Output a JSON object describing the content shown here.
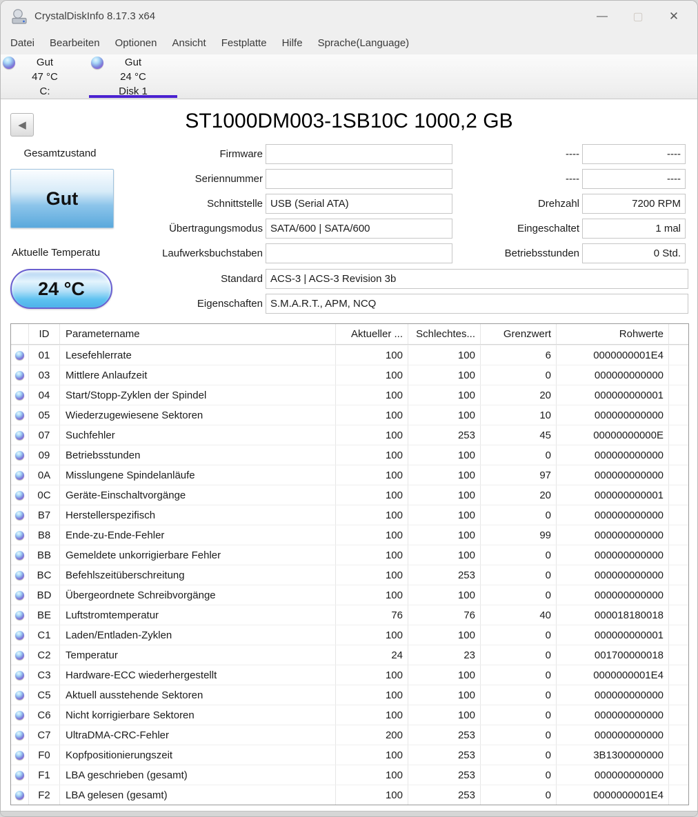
{
  "window": {
    "title": "CrystalDiskInfo 8.17.3 x64"
  },
  "icons": {
    "back": "◀",
    "minimize": "—",
    "maximize": "▢",
    "close": "✕"
  },
  "menu": {
    "items": [
      {
        "label": "Datei"
      },
      {
        "label": "Bearbeiten"
      },
      {
        "label": "Optionen"
      },
      {
        "label": "Ansicht"
      },
      {
        "label": "Festplatte"
      },
      {
        "label": "Hilfe"
      },
      {
        "label": "Sprache(Language)"
      }
    ]
  },
  "disk_tabs": [
    {
      "status": "Gut",
      "temperature": "47 °C",
      "name": "C:",
      "selected": false
    },
    {
      "status": "Gut",
      "temperature": "24 °C",
      "name": "Disk 1",
      "selected": true
    }
  ],
  "drive": {
    "title": "ST1000DM003-1SB10C 1000,2 GB",
    "health_label": "Gesamtzustand",
    "health_value": "Gut",
    "temp_label": "Aktuelle Temperatu",
    "temp_value": "24 °C",
    "fields_left": [
      {
        "label": "Firmware",
        "value": ""
      },
      {
        "label": "Seriennummer",
        "value": ""
      },
      {
        "label": "Schnittstelle",
        "value": "USB (Serial ATA)"
      },
      {
        "label": "Übertragungsmodus",
        "value": "SATA/600 | SATA/600"
      },
      {
        "label": "Laufwerksbuchstaben",
        "value": ""
      }
    ],
    "fields_right": [
      {
        "label": "----",
        "value": "----"
      },
      {
        "label": "----",
        "value": "----"
      },
      {
        "label": "Drehzahl",
        "value": "7200 RPM"
      },
      {
        "label": "Eingeschaltet",
        "value": "1 mal"
      },
      {
        "label": "Betriebsstunden",
        "value": "0 Std."
      }
    ],
    "fields_wide": [
      {
        "label": "Standard",
        "value": "ACS-3 | ACS-3 Revision 3b"
      },
      {
        "label": "Eigenschaften",
        "value": "S.M.A.R.T., APM, NCQ"
      }
    ]
  },
  "smart_table": {
    "headers": {
      "id": "ID",
      "name": "Parametername",
      "current": "Aktueller ...",
      "worst": "Schlechtes...",
      "threshold": "Grenzwert",
      "raw": "Rohwerte"
    },
    "rows": [
      {
        "id": "01",
        "name": "Lesefehlerrate",
        "current": "100",
        "worst": "100",
        "threshold": "6",
        "raw": "0000000001E4"
      },
      {
        "id": "03",
        "name": "Mittlere Anlaufzeit",
        "current": "100",
        "worst": "100",
        "threshold": "0",
        "raw": "000000000000"
      },
      {
        "id": "04",
        "name": "Start/Stopp-Zyklen der Spindel",
        "current": "100",
        "worst": "100",
        "threshold": "20",
        "raw": "000000000001"
      },
      {
        "id": "05",
        "name": "Wiederzugewiesene Sektoren",
        "current": "100",
        "worst": "100",
        "threshold": "10",
        "raw": "000000000000"
      },
      {
        "id": "07",
        "name": "Suchfehler",
        "current": "100",
        "worst": "253",
        "threshold": "45",
        "raw": "00000000000E"
      },
      {
        "id": "09",
        "name": "Betriebsstunden",
        "current": "100",
        "worst": "100",
        "threshold": "0",
        "raw": "000000000000"
      },
      {
        "id": "0A",
        "name": "Misslungene Spindelanläufe",
        "current": "100",
        "worst": "100",
        "threshold": "97",
        "raw": "000000000000"
      },
      {
        "id": "0C",
        "name": "Geräte-Einschaltvorgänge",
        "current": "100",
        "worst": "100",
        "threshold": "20",
        "raw": "000000000001"
      },
      {
        "id": "B7",
        "name": "Herstellerspezifisch",
        "current": "100",
        "worst": "100",
        "threshold": "0",
        "raw": "000000000000"
      },
      {
        "id": "B8",
        "name": "Ende-zu-Ende-Fehler",
        "current": "100",
        "worst": "100",
        "threshold": "99",
        "raw": "000000000000"
      },
      {
        "id": "BB",
        "name": "Gemeldete unkorrigierbare Fehler",
        "current": "100",
        "worst": "100",
        "threshold": "0",
        "raw": "000000000000"
      },
      {
        "id": "BC",
        "name": "Befehlszeitüberschreitung",
        "current": "100",
        "worst": "253",
        "threshold": "0",
        "raw": "000000000000"
      },
      {
        "id": "BD",
        "name": "Übergeordnete Schreibvorgänge",
        "current": "100",
        "worst": "100",
        "threshold": "0",
        "raw": "000000000000"
      },
      {
        "id": "BE",
        "name": "Luftstromtemperatur",
        "current": "76",
        "worst": "76",
        "threshold": "40",
        "raw": "000018180018"
      },
      {
        "id": "C1",
        "name": "Laden/Entladen-Zyklen",
        "current": "100",
        "worst": "100",
        "threshold": "0",
        "raw": "000000000001"
      },
      {
        "id": "C2",
        "name": "Temperatur",
        "current": "24",
        "worst": "23",
        "threshold": "0",
        "raw": "001700000018"
      },
      {
        "id": "C3",
        "name": "Hardware-ECC wiederhergestellt",
        "current": "100",
        "worst": "100",
        "threshold": "0",
        "raw": "0000000001E4"
      },
      {
        "id": "C5",
        "name": "Aktuell ausstehende Sektoren",
        "current": "100",
        "worst": "100",
        "threshold": "0",
        "raw": "000000000000"
      },
      {
        "id": "C6",
        "name": "Nicht korrigierbare Sektoren",
        "current": "100",
        "worst": "100",
        "threshold": "0",
        "raw": "000000000000"
      },
      {
        "id": "C7",
        "name": "UltraDMA-CRC-Fehler",
        "current": "200",
        "worst": "253",
        "threshold": "0",
        "raw": "000000000000"
      },
      {
        "id": "F0",
        "name": "Kopfpositionierungszeit",
        "current": "100",
        "worst": "253",
        "threshold": "0",
        "raw": "3B1300000000"
      },
      {
        "id": "F1",
        "name": "LBA geschrieben (gesamt)",
        "current": "100",
        "worst": "253",
        "threshold": "0",
        "raw": "000000000000"
      },
      {
        "id": "F2",
        "name": "LBA gelesen (gesamt)",
        "current": "100",
        "worst": "253",
        "threshold": "0",
        "raw": "0000000001E4"
      }
    ]
  },
  "colors": {
    "selected_tab_underline": "#4a21d0",
    "health_button_blue": "#5aa9dc",
    "temp_pill_blue": "#5fc2f0",
    "titlebar_bg": "#efefef"
  }
}
